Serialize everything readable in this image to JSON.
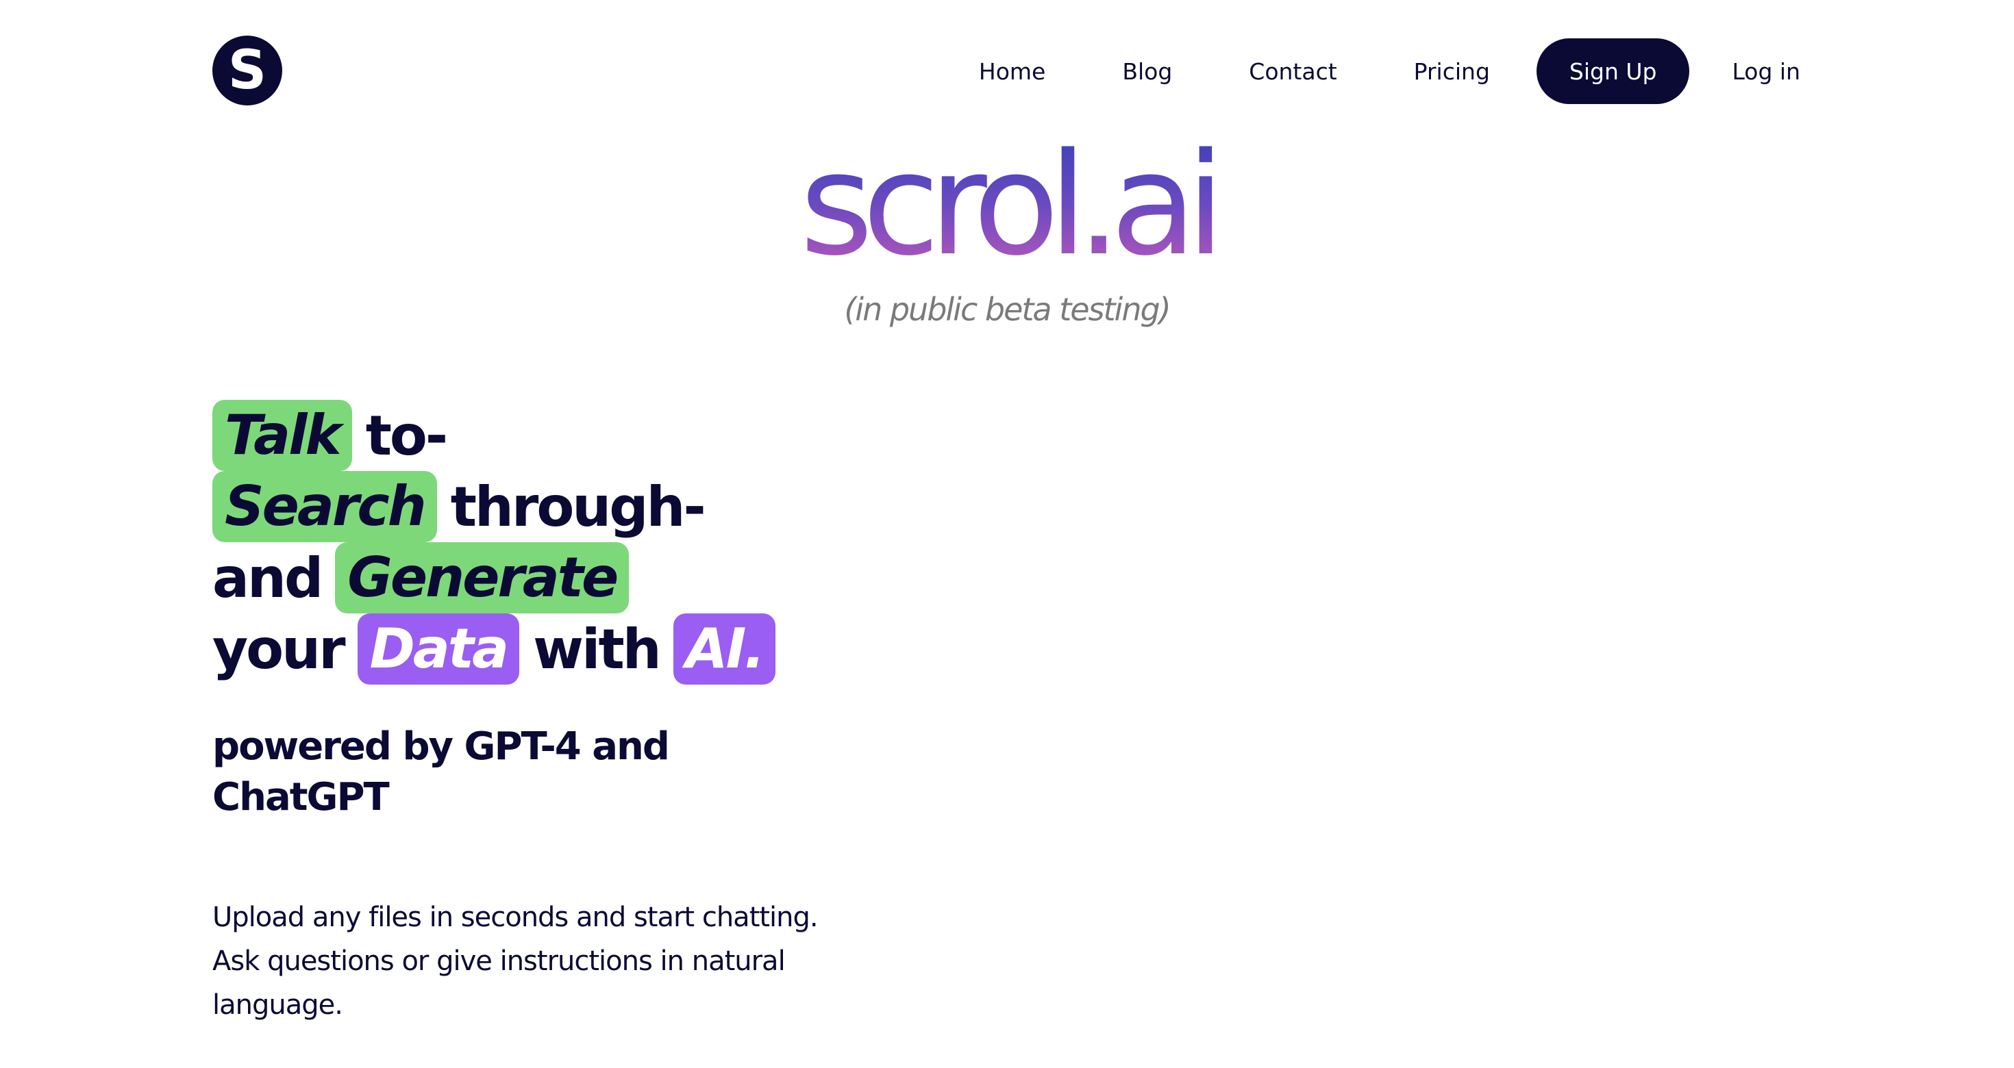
{
  "header": {
    "logo_letter": "S",
    "nav": {
      "home": "Home",
      "blog": "Blog",
      "contact": "Contact",
      "pricing": "Pricing",
      "signup": "Sign Up",
      "login": "Log in"
    }
  },
  "brand": {
    "wordmark": "scrol.ai",
    "beta_note": "(in public beta testing)"
  },
  "hero": {
    "line1": {
      "pill": "Talk",
      "rest": "to-"
    },
    "line2": {
      "pill": "Search",
      "rest": "through-"
    },
    "line3": {
      "lead": "and",
      "pill": "Generate"
    },
    "line4": {
      "lead": "your",
      "pill_data": "Data",
      "mid": "with",
      "pill_ai": "AI."
    },
    "subhead": "powered by GPT-4 and ChatGPT",
    "description": "Upload any files in seconds and start chatting. Ask questions or give instructions in natural language."
  },
  "colors": {
    "navy": "#0b0a35",
    "green_highlight": "#7dd87a",
    "purple_highlight": "#9a5ef2",
    "gradient_top": "#3440b8",
    "gradient_bottom": "#c659b9",
    "muted_gray": "#7a7a7a"
  }
}
